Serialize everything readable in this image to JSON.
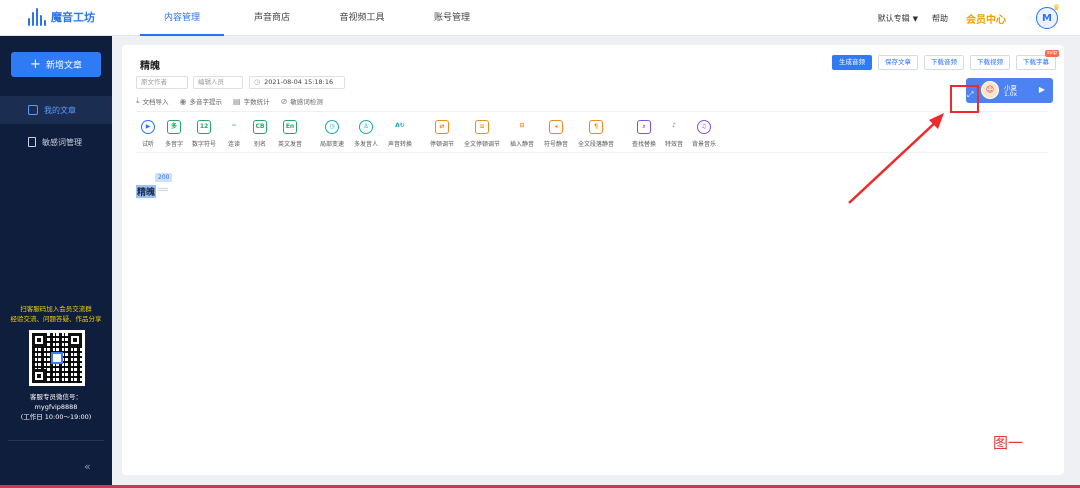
{
  "brand": {
    "name": "魔音工坊"
  },
  "nav": {
    "items": [
      "内容管理",
      "声音商店",
      "音视频工具",
      "账号管理"
    ],
    "active": 0
  },
  "topright": {
    "album": "默认专辑",
    "help": "帮助",
    "vip": "会员中心",
    "avatar_letter": "M"
  },
  "sidebar": {
    "new_article": "新增文章",
    "items": [
      "我的文章",
      "敏感词管理"
    ],
    "promo_line1": "扫客服码加入会员交流群",
    "promo_line2": "经验交流、问题答疑、作品分享",
    "contact_line1": "客服专员微信号：",
    "contact_line2": "mygfvip8888",
    "contact_line3": "(工作日 10:00～19:00)",
    "collapse": "«"
  },
  "doc": {
    "title": "精魄",
    "author_placeholder": "原文作者",
    "editor_placeholder": "编辑人员",
    "date": "2021-08-04 15:18:16",
    "tools_row1": [
      "文档导入",
      "多音字提示",
      "字数统计",
      "敏感词检测"
    ],
    "actions": [
      "生成音频",
      "保存文章",
      "下载音频",
      "下载视频",
      "下载字幕"
    ],
    "svip": "svip",
    "count": "200",
    "content": "精魄"
  },
  "tools": [
    {
      "label": "试听",
      "glyph": "▶",
      "color": "blue"
    },
    {
      "label": "多音字",
      "glyph": "多",
      "color": "green"
    },
    {
      "label": "数字符号",
      "glyph": "12",
      "color": "green"
    },
    {
      "label": "连读",
      "glyph": "~",
      "color": "green"
    },
    {
      "label": "别名",
      "glyph": "CB",
      "color": "green"
    },
    {
      "label": "英文发音",
      "glyph": "En",
      "color": "green"
    },
    {
      "label": "局部变速",
      "glyph": "◷",
      "color": "teal"
    },
    {
      "label": "多发音人",
      "glyph": "♙",
      "color": "teal"
    },
    {
      "label": "声音转换",
      "glyph": "A↻",
      "color": "teal"
    },
    {
      "label": "停顿调节",
      "glyph": "⇄",
      "color": "orange"
    },
    {
      "label": "全文停顿调节",
      "glyph": "≡",
      "color": "orange"
    },
    {
      "label": "插入静音",
      "glyph": "⊟",
      "color": "orange"
    },
    {
      "label": "符号静音",
      "glyph": "◂",
      "color": "orange"
    },
    {
      "label": "全文段落静音",
      "glyph": "¶",
      "color": "orange"
    },
    {
      "label": "查找替换",
      "glyph": "⌕",
      "color": "purple"
    },
    {
      "label": "特效音",
      "glyph": "♪",
      "color": "purple"
    },
    {
      "label": "背景音乐",
      "glyph": "♫",
      "color": "purple"
    }
  ],
  "voice": {
    "name": "小夏",
    "speed": "1.0x"
  },
  "figure_label": "图一"
}
